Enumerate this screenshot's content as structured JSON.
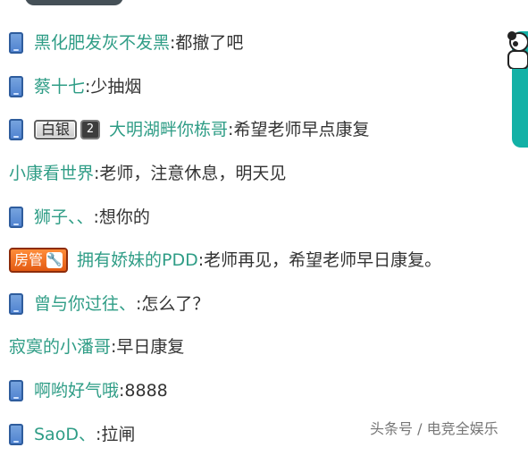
{
  "chat": {
    "messages": [
      {
        "user": "黑化肥发灰不发黑",
        "text": "都撤了吧"
      },
      {
        "user": "蔡十七",
        "text": "少抽烟"
      },
      {
        "badge": {
          "type": "silver",
          "label": "白银",
          "level": "2"
        },
        "user": "大明湖畔你栋哥",
        "text": "希望老师早点康复"
      },
      {
        "user": "小康看世界",
        "text": "老师，注意休息，明天见"
      },
      {
        "user": "狮子、、",
        "text": "想你的"
      },
      {
        "badge": {
          "type": "admin",
          "label": "房管"
        },
        "user": "拥有娇妹的PDD",
        "text": "老师再见，希望老师早日康复。"
      },
      {
        "user": "曾与你过往、",
        "text": "怎么了？"
      },
      {
        "user": "寂寞的小潘哥",
        "text": "早日康复"
      },
      {
        "user": "啊哟好气哦",
        "text": "8888"
      },
      {
        "user": "SaoD、",
        "text": "拉闸"
      }
    ]
  },
  "watermark": "头条号 / 电竞全娱乐"
}
